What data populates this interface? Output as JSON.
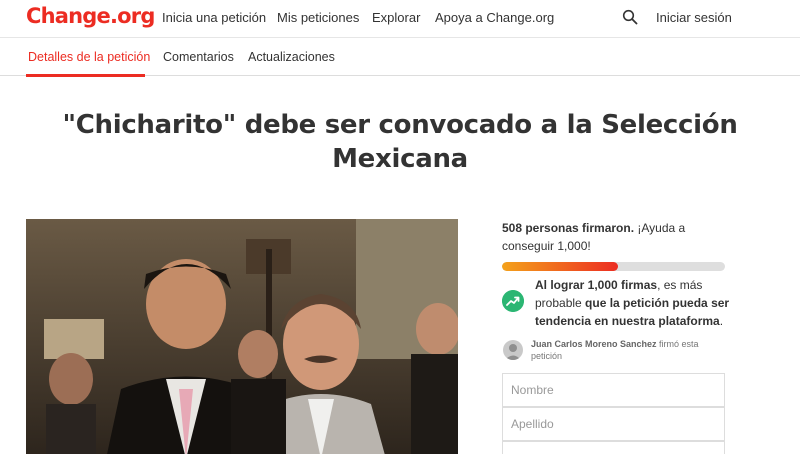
{
  "header": {
    "logo": "Change.org",
    "nav": [
      "Inicia una petición",
      "Mis peticiones",
      "Explorar",
      "Apoya a Change.org"
    ],
    "login": "Iniciar sesión"
  },
  "tabs": [
    {
      "label": "Detalles de la petición",
      "active": true
    },
    {
      "label": "Comentarios",
      "active": false
    },
    {
      "label": "Actualizaciones",
      "active": false
    }
  ],
  "petition": {
    "title": "\"Chicharito\" debe ser convocado a la Selección Mexicana"
  },
  "sidebar": {
    "count_bold": "508 personas firmaron.",
    "count_rest": " ¡Ayuda a conseguir 1,000!",
    "progress_fraction": 0.52,
    "trend_bold_1": "Al lograr 1,000 firmas",
    "trend_mid": ", es más probable ",
    "trend_bold_2": "que la petición pueda ser tendencia en nuestra plataforma",
    "trend_end": ".",
    "signer_name": "Juan Carlos Moreno Sanchez",
    "signer_action": " firmó esta petición",
    "first_name_placeholder": "Nombre",
    "last_name_placeholder": "Apellido"
  },
  "colors": {
    "brand": "#ec2c22",
    "trend": "#2bb673"
  }
}
